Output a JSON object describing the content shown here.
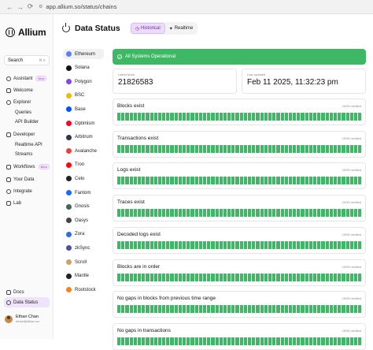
{
  "browser": {
    "url": "app.allium.so/status/chains"
  },
  "app": {
    "brand": "Allium"
  },
  "sidebar": {
    "search_label": "Search",
    "search_shortcut": "⌘ K",
    "items": [
      {
        "label": "Assistant",
        "badge": "New"
      },
      {
        "label": "Welcome"
      },
      {
        "label": "Explorer"
      },
      {
        "label": "Queries"
      },
      {
        "label": "API Builder"
      },
      {
        "label": "Developer"
      },
      {
        "label": "Realtime API"
      },
      {
        "label": "Streams"
      },
      {
        "label": "Workflows",
        "badge": "Beta"
      },
      {
        "label": "Your Data"
      },
      {
        "label": "Integrate"
      },
      {
        "label": "Lab"
      },
      {
        "label": "Docs"
      },
      {
        "label": "Data Status"
      }
    ],
    "user": {
      "name": "Ethan Chan",
      "email": "ethan@allium.so"
    }
  },
  "header": {
    "title": "Data Status",
    "tabs": [
      {
        "label": "Historical",
        "active": true
      },
      {
        "label": "Realtime",
        "active": false
      }
    ]
  },
  "chains": [
    {
      "label": "Ethereum",
      "color": "#627eea"
    },
    {
      "label": "Solana",
      "color": "#111111"
    },
    {
      "label": "Polygon",
      "color": "#8247e5"
    },
    {
      "label": "BSC",
      "color": "#f0b90b"
    },
    {
      "label": "Base",
      "color": "#0052ff"
    },
    {
      "label": "Optimism",
      "color": "#ff0420"
    },
    {
      "label": "Arbitrum",
      "color": "#2d374b"
    },
    {
      "label": "Avalanche",
      "color": "#e84142"
    },
    {
      "label": "Tron",
      "color": "#ff060a"
    },
    {
      "label": "Celo",
      "color": "#222222"
    },
    {
      "label": "Fantom",
      "color": "#1969ff"
    },
    {
      "label": "Gnosis",
      "color": "#3e6957"
    },
    {
      "label": "Oasys",
      "color": "#444444"
    },
    {
      "label": "Zora",
      "color": "#2f6de1"
    },
    {
      "label": "zkSync",
      "color": "#4e529a"
    },
    {
      "label": "Scroll",
      "color": "#c9a36b"
    },
    {
      "label": "Mantle",
      "color": "#222222"
    },
    {
      "label": "Rootstock",
      "color": "#f58220"
    }
  ],
  "status": {
    "banner": "All Systems Operational",
    "latest_block_label": "Latest block",
    "latest_block": "21826583",
    "last_updated_label": "Last updated",
    "last_updated": "Feb 11 2025, 11:32:23 pm",
    "checks": [
      {
        "name": "Blocks exist",
        "verified": "100% verified"
      },
      {
        "name": "Transactions exist",
        "verified": "100% verified"
      },
      {
        "name": "Logs exist",
        "verified": "100% verified"
      },
      {
        "name": "Traces exist",
        "verified": "100% verified"
      },
      {
        "name": "Decoded logs exist",
        "verified": "100% verified"
      },
      {
        "name": "Blocks are in order",
        "verified": "100% verified"
      },
      {
        "name": "No gaps in blocks from previous time range",
        "verified": "100% verified"
      },
      {
        "name": "No gaps in transactions",
        "verified": "100% verified"
      }
    ]
  },
  "colors": {
    "accent": "#9a49d9",
    "success": "#3fb865"
  }
}
